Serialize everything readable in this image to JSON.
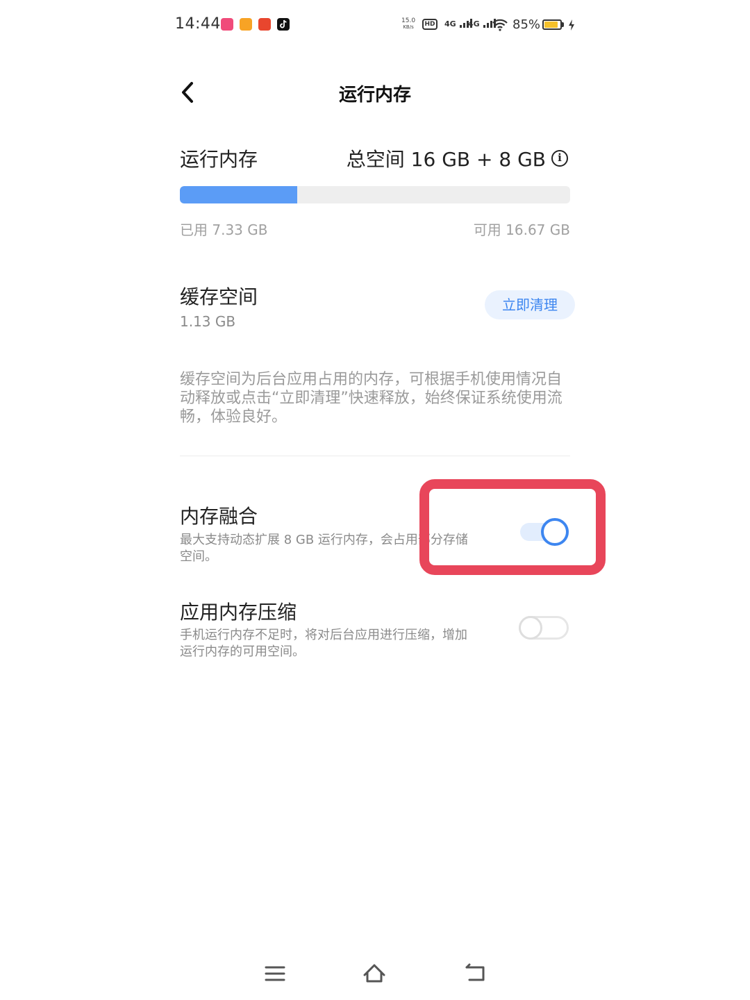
{
  "status_bar": {
    "time": "14:44",
    "apps": [
      {
        "icon": "app-icon-1",
        "color": "#f04b7a"
      },
      {
        "icon": "weibo-icon",
        "color": "#f7a325"
      },
      {
        "icon": "app-icon-3",
        "color": "#e8462e"
      },
      {
        "icon": "tiktok-icon",
        "color": "#111111"
      }
    ],
    "net_speed_value": "15.0",
    "net_speed_unit": "KB/s",
    "hd_label": "HD",
    "signal_1_label": "4G",
    "signal_2_label": "4G",
    "battery_percent_text": "85%",
    "battery_level": 0.85,
    "charging": true
  },
  "header": {
    "title": "运行内存"
  },
  "ram": {
    "label": "运行内存",
    "total": "总空间 16 GB + 8 GB",
    "used_fraction": 0.3,
    "used": "已用 7.33 GB",
    "available": "可用 16.67 GB",
    "accent_color": "#5b9cf6"
  },
  "cache": {
    "title": "缓存空间",
    "size": "1.13 GB",
    "clean_button": "立即清理",
    "description": "缓存空间为后台应用占用的内存，可根据手机使用情况自动释放或点击“立即清理”快速释放，始终保证系统使用流畅，体验良好。"
  },
  "memory_fusion": {
    "title": "内存融合",
    "subtitle": "最大支持动态扩展 8 GB 运行内存，会占用部分存储空间。",
    "enabled": true
  },
  "memory_compression": {
    "title": "应用内存压缩",
    "subtitle": "手机运行内存不足时，将对后台应用进行压缩，增加运行内存的可用空间。",
    "enabled": false
  },
  "annotation": {
    "color": "#e8465a"
  },
  "nav": {
    "menu_icon": "menu-icon",
    "home_icon": "home-icon",
    "back_icon": "back-nav-icon"
  }
}
